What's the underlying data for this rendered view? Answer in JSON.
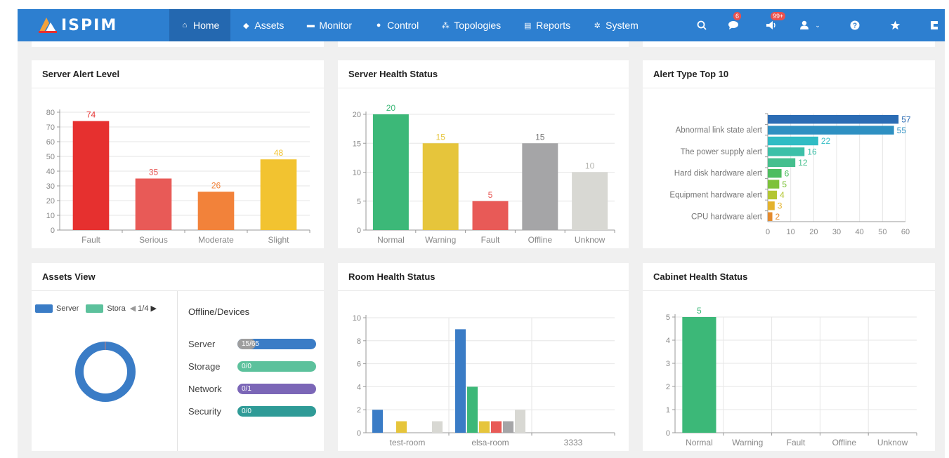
{
  "nav": {
    "brand": "ISPIM",
    "items": [
      {
        "label": "Home",
        "icon": "home-icon",
        "glyph": "⌂"
      },
      {
        "label": "Assets",
        "icon": "layers-icon",
        "glyph": "◆"
      },
      {
        "label": "Monitor",
        "icon": "monitor-icon",
        "glyph": "▬"
      },
      {
        "label": "Control",
        "icon": "control-icon",
        "glyph": "●"
      },
      {
        "label": "Topologies",
        "icon": "topology-icon",
        "glyph": "⁂"
      },
      {
        "label": "Reports",
        "icon": "report-icon",
        "glyph": "▤"
      },
      {
        "label": "System",
        "icon": "gear-icon",
        "glyph": "✲"
      }
    ],
    "right_icons": {
      "search": "search-icon",
      "messages": {
        "icon": "message-icon",
        "badge": "6"
      },
      "alerts": {
        "icon": "speaker-icon",
        "badge": "99+"
      },
      "user": "user-icon",
      "help": "help-icon",
      "favorite": "star-icon",
      "more": "exit-icon"
    },
    "active": "Home",
    "colors": {
      "bar": "#2d7fd0",
      "active": "#2468b0"
    }
  },
  "panels": {
    "server_alert_level": {
      "title": "Server Alert Level"
    },
    "server_health_status": {
      "title": "Server Health Status"
    },
    "alert_type_top10": {
      "title": "Alert Type Top 10"
    },
    "assets_view": {
      "title": "Assets View",
      "legend": [
        {
          "label": "Server",
          "color": "#3a7cc6"
        },
        {
          "label": "Stora",
          "color": "#5cc19c"
        }
      ],
      "pager": "1/4",
      "offline_title": "Offline/Devices",
      "devices": [
        {
          "label": "Server",
          "value": "15/65",
          "color": "#3a7cc6",
          "offline_fraction": 0.23
        },
        {
          "label": "Storage",
          "value": "0/0",
          "color": "#5cc19c",
          "offline_fraction": 0
        },
        {
          "label": "Network",
          "value": "0/1",
          "color": "#7b66b7",
          "offline_fraction": 0
        },
        {
          "label": "Security",
          "value": "0/0",
          "color": "#2f9b97",
          "offline_fraction": 0
        }
      ]
    },
    "room_health_status": {
      "title": "Room Health Status"
    },
    "cabinet_health_status": {
      "title": "Cabinet Health Status"
    }
  },
  "chart_data": [
    {
      "id": "server_alert_level",
      "type": "bar",
      "categories": [
        "Fault",
        "Serious",
        "Moderate",
        "Slight"
      ],
      "values": [
        74,
        35,
        26,
        48
      ],
      "colors": [
        "#e6302f",
        "#e85a57",
        "#f2823a",
        "#f2c330"
      ],
      "ylim": [
        0,
        80
      ],
      "yticks": [
        0,
        10,
        20,
        30,
        40,
        50,
        60,
        70,
        80
      ],
      "grid": true,
      "data_labels": true
    },
    {
      "id": "server_health_status",
      "type": "bar",
      "categories": [
        "Normal",
        "Warning",
        "Fault",
        "Offline",
        "Unknow"
      ],
      "values": [
        20,
        15,
        5,
        15,
        10
      ],
      "colors": [
        "#3cb878",
        "#e6c53b",
        "#e85a57",
        "#a5a5a7",
        "#d8d8d3"
      ],
      "ylim": [
        0,
        20
      ],
      "yticks": [
        0,
        5,
        10,
        15,
        20
      ],
      "grid": true,
      "data_labels": true
    },
    {
      "id": "alert_type_top10",
      "type": "bar",
      "orientation": "horizontal",
      "categories": [
        "Abnormal link state alert",
        "The power supply alert",
        "Hard disk hardware alert",
        "Equipment hardware alert",
        "CPU hardware alert"
      ],
      "values": [
        57,
        55,
        22,
        16,
        12,
        6,
        5,
        4,
        3,
        2
      ],
      "colors": [
        "#2b6cb4",
        "#2e90c2",
        "#2fbcc4",
        "#3cc0a8",
        "#45bf8e",
        "#4cbd5f",
        "#7dc23a",
        "#b3c632",
        "#e4b32d",
        "#e48a2c"
      ],
      "xlim": [
        0,
        60
      ],
      "xticks": [
        0,
        10,
        20,
        30,
        40,
        50,
        60
      ],
      "grid": true,
      "data_labels": true
    },
    {
      "id": "assets_view",
      "type": "pie",
      "subtype": "donut",
      "labels": [
        "Server",
        "Storage"
      ],
      "values": [
        65,
        0
      ],
      "colors": [
        "#3a7cc6",
        "#5cc19c"
      ]
    },
    {
      "id": "room_health_status",
      "type": "bar",
      "categories": [
        "test-room",
        "elsa-room",
        "3333"
      ],
      "series": [
        {
          "values": [
            2,
            9,
            0
          ],
          "color": "#3a7cc6"
        },
        {
          "values": [
            0,
            4,
            0
          ],
          "color": "#3cb878"
        },
        {
          "values": [
            1,
            1,
            0
          ],
          "color": "#e6c53b"
        },
        {
          "values": [
            0,
            1,
            0
          ],
          "color": "#e85a57"
        },
        {
          "values": [
            0,
            1,
            0
          ],
          "color": "#a5a5a7"
        },
        {
          "values": [
            1,
            2,
            0
          ],
          "color": "#d8d8d3"
        }
      ],
      "ylim": [
        0,
        10
      ],
      "yticks": [
        0,
        2,
        4,
        6,
        8,
        10
      ],
      "grid": true
    },
    {
      "id": "cabinet_health_status",
      "type": "bar",
      "categories": [
        "Normal",
        "Warning",
        "Fault",
        "Offline",
        "Unknow"
      ],
      "values": [
        5,
        0,
        0,
        0,
        0
      ],
      "colors": [
        "#3cb878",
        "#e6c53b",
        "#e85a57",
        "#a5a5a7",
        "#d8d8d3"
      ],
      "ylim": [
        0,
        5
      ],
      "yticks": [
        0,
        1,
        2,
        3,
        4,
        5
      ],
      "grid": true,
      "data_labels": true
    }
  ]
}
